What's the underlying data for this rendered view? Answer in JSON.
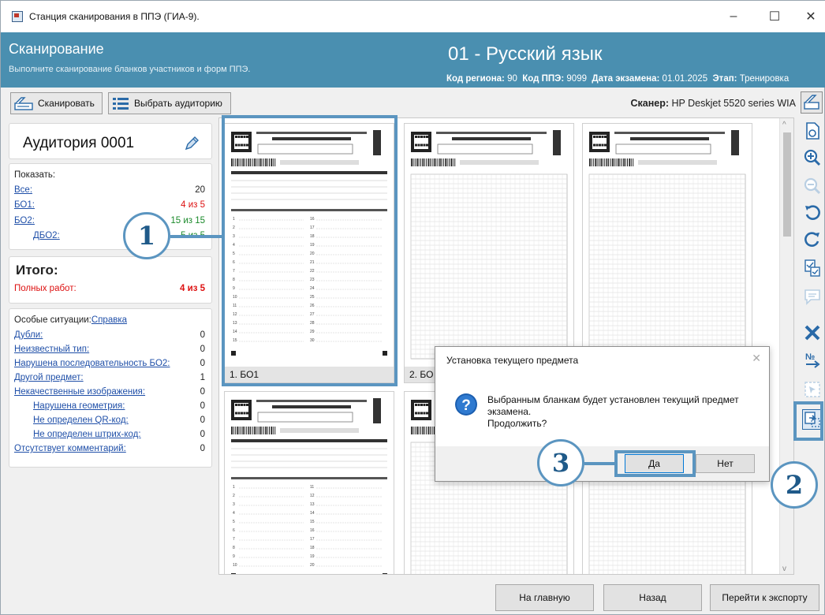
{
  "window": {
    "title": "Станция сканирования в ППЭ (ГИА-9).",
    "controls": [
      "–",
      "☐",
      "✕"
    ]
  },
  "header": {
    "title": "Сканирование",
    "subtitle": "Выполните сканирование бланков участников и форм ППЭ.",
    "subject": "01 - Русский язык",
    "region_label": "Код региона:",
    "region_value": "90",
    "ppe_label": "Код ППЭ:",
    "ppe_value": "9099",
    "date_label": "Дата экзамена:",
    "date_value": "01.01.2025",
    "stage_label": "Этап:",
    "stage_value": "Тренировка"
  },
  "toolbar": {
    "scan_label": "Сканировать",
    "choose_room_label": "Выбрать аудиторию",
    "scanner_label": "Сканер:",
    "scanner_value": "HP Deskjet 5520 series WIA"
  },
  "left": {
    "room_title": "Аудитория 0001",
    "show_label": "Показать:",
    "rows": [
      {
        "label": "Все:",
        "value": "20"
      },
      {
        "label": "БО1:",
        "value": "4 из 5"
      },
      {
        "label": "БО2:",
        "value": "15 из 15"
      },
      {
        "label": "ДБО2:",
        "value": "5 из 5"
      }
    ],
    "total_title": "Итого:",
    "total_label": "Полных работ:",
    "total_value": "4 из 5",
    "special_label": "Особые ситуации:",
    "help_link": "Справка",
    "special_rows": [
      {
        "label": "Дубли:",
        "value": "0"
      },
      {
        "label": "Неизвестный тип:",
        "value": "0"
      },
      {
        "label": "Нарушена последовательность БО2:",
        "value": "0"
      },
      {
        "label": "Другой предмет:",
        "value": "1"
      },
      {
        "label": "Некачественные изображения:",
        "value": "0"
      },
      {
        "label": "Нарушена геометрия:",
        "value": "0"
      },
      {
        "label": "Не определен QR-код:",
        "value": "0"
      },
      {
        "label": "Не определен штрих-код:",
        "value": "0"
      },
      {
        "label": "Отсутствует комментарий:",
        "value": "0"
      }
    ]
  },
  "thumbs": [
    {
      "caption": "1. БО1",
      "heading": "БЛАНК ОТВЕТОВ № 1"
    },
    {
      "caption": "2. БО",
      "heading": "БЛАНК ОТВЕТОВ № 2"
    },
    {
      "caption": "",
      "heading": "ДОПОЛНИТЕЛЬНЫЙ БЛАНК ОТВЕТОВ № 2"
    },
    {
      "caption": "",
      "heading": "БЛАНК ОТВЕТОВ № 1"
    },
    {
      "caption": "",
      "heading": ""
    },
    {
      "caption": "",
      "heading": ""
    }
  ],
  "dialog": {
    "title": "Установка текущего предмета",
    "message_line1": "Выбранным бланкам будет установлен текущий предмет",
    "message_line2": "экзамена.",
    "message_line3": "Продолжить?",
    "yes": "Да",
    "no": "Нет"
  },
  "bottom": {
    "home": "На главную",
    "back": "Назад",
    "export": "Перейти к экспорту"
  },
  "callouts": [
    "1",
    "2",
    "3"
  ],
  "colors": {
    "header_bg": "#4a8fb0",
    "accent": "#5b95c0",
    "link": "#1f4fa8",
    "error": "#d11111",
    "ok": "#1a8a2a"
  }
}
